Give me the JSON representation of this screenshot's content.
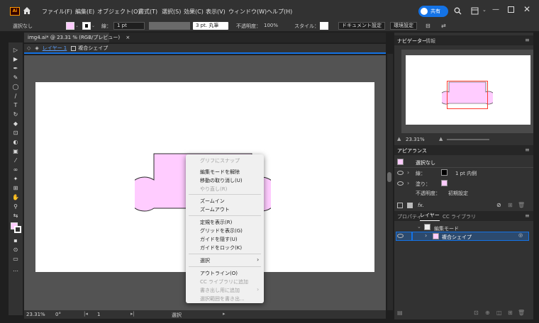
{
  "menubar": {
    "logo": "Ai",
    "items": [
      "ファイル(F)",
      "編集(E)",
      "オブジェクト(O)",
      "書式(T)",
      "選択(S)",
      "効果(C)",
      "表示(V)",
      "ウィンドウ(W)",
      "ヘルプ(H)"
    ],
    "share_label": "共有"
  },
  "controlbar": {
    "selection": "選択なし",
    "stroke_label": "線：",
    "stroke_weight": "1 pt",
    "brush": "3 pt. 丸筆",
    "opacity_label": "不透明度：",
    "opacity_value": "100%",
    "style_label": "スタイル：",
    "document_settings": "ドキュメント設定",
    "preferences": "環境設定"
  },
  "document": {
    "tab_title": "img4.ai* @ 23.31 % (RGB/プレビュー)",
    "close_glyph": "×"
  },
  "breadcrumb": {
    "layer": "レイヤー 1",
    "object": "複合シェイプ"
  },
  "context_menu": {
    "items": [
      {
        "label": "グリフにスナップ",
        "disabled": true
      },
      {
        "label": "編集モードを解除",
        "disabled": false
      },
      {
        "label": "移動の取り消し(U)",
        "disabled": false
      },
      {
        "label": "やり直し(R)",
        "disabled": true
      },
      {
        "label": "ズームイン",
        "disabled": false
      },
      {
        "label": "ズームアウト",
        "disabled": false
      },
      {
        "label": "定規を表示(R)",
        "disabled": false
      },
      {
        "label": "グリッドを表示(G)",
        "disabled": false
      },
      {
        "label": "ガイドを隠す(U)",
        "disabled": false
      },
      {
        "label": "ガイドをロック(K)",
        "disabled": false
      },
      {
        "label": "選択",
        "disabled": false
      },
      {
        "label": "アウトライン(O)",
        "disabled": false
      },
      {
        "label": "CC ライブラリに追加",
        "disabled": true
      },
      {
        "label": "書き出し用に追加",
        "disabled": true
      },
      {
        "label": "選択範囲を書き出...",
        "disabled": true
      }
    ]
  },
  "statusbar": {
    "zoom": "23.31%",
    "rotation": "0°",
    "artboard": "1",
    "mode": "選択"
  },
  "navigator": {
    "tab_active": "ナビゲーター",
    "tab_other": "情報",
    "zoom": "23.31%"
  },
  "appearance": {
    "title": "アピアランス",
    "selection": "選択なし",
    "stroke_label": "線：",
    "stroke_value": "1 pt  内側",
    "fill_label": "塗り：",
    "opacity_label": "不透明度：",
    "opacity_value": "初期設定",
    "fx": "fx."
  },
  "layers": {
    "tabs": [
      "プロパティ",
      "レイヤー",
      "CC ライブラリ"
    ],
    "edit_mode": "編集モード",
    "item": "複合シェイプ"
  },
  "colors": {
    "accent": "#1473e6",
    "shape_fill": "#ffccff",
    "artboard": "#ffffff",
    "canvas": "#535353"
  }
}
